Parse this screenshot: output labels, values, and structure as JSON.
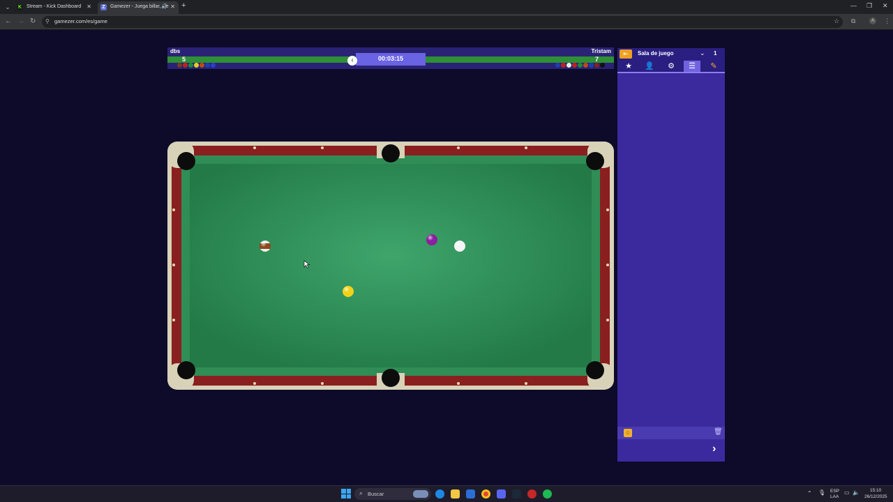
{
  "browser": {
    "tabs": [
      {
        "title": "Stream - Kick Dashboard",
        "favicon": "K"
      },
      {
        "title": "Gamezer - Juega billar, aje",
        "favicon": "Z"
      }
    ],
    "new_tab": "+",
    "url": "gamezer.com/es/game"
  },
  "game": {
    "player1": {
      "name": "dbs",
      "score": "5"
    },
    "player2": {
      "name": "Tristam",
      "score": "7"
    },
    "timer": "00:03:15",
    "colors": {
      "felt": "#3a9a63",
      "rail": "#8a1f1f",
      "hud": "#2a2275",
      "bar": "#2e8f36"
    },
    "balls_on_table": [
      {
        "name": "striped-brown-ball",
        "color": "#8b4a22",
        "striped": true
      },
      {
        "name": "purple-ball",
        "color": "#8a1fa0",
        "striped": false
      },
      {
        "name": "cue-ball",
        "color": "#f4f4f4",
        "striped": false
      },
      {
        "name": "yellow-ball",
        "color": "#f2d21a",
        "striped": false
      }
    ]
  },
  "panel": {
    "title": "Sala de juego",
    "count": "1",
    "tabs": [
      "star-icon",
      "user-icon",
      "gear-icon",
      "list-icon",
      "edit-icon"
    ],
    "active_tab": 3
  },
  "taskbar": {
    "search_placeholder": "Buscar",
    "lang": "ESP",
    "lang_sub": "LAA",
    "time": "15:10",
    "date": "26/12/2025"
  }
}
